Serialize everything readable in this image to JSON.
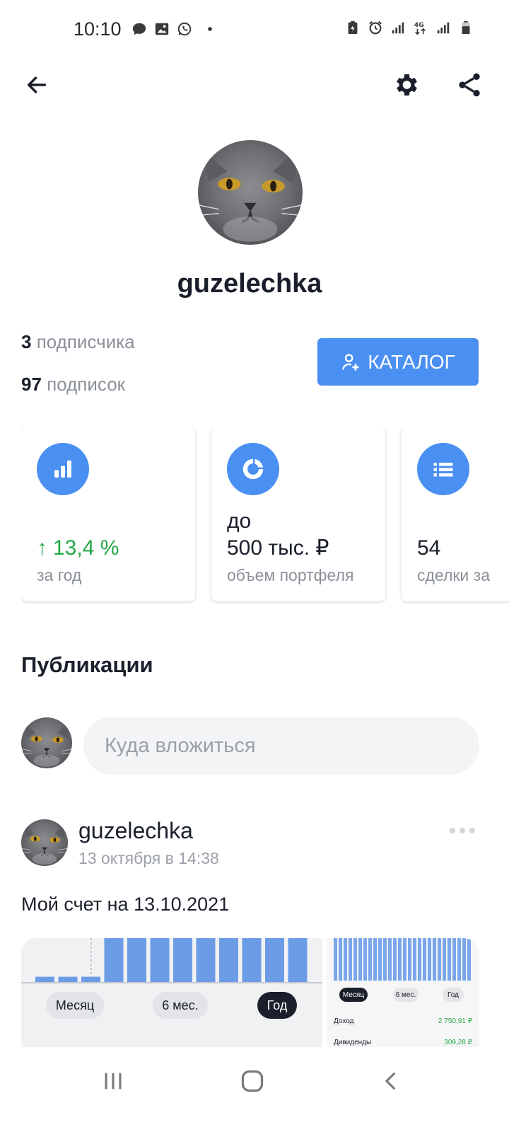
{
  "status_bar": {
    "time": "10:10",
    "left_icons": [
      "message-icon",
      "gallery-icon",
      "whatsapp-icon",
      "dot-icon"
    ],
    "right_icons": [
      "battery-saver-icon",
      "alarm-icon",
      "signal-icon",
      "4g-icon",
      "signal-icon",
      "battery-icon"
    ]
  },
  "header": {
    "back_icon": "arrow-left-icon",
    "settings_icon": "gear-icon",
    "share_icon": "share-icon"
  },
  "profile": {
    "username": "guzelechka",
    "followers_count": "3",
    "followers_label": "подписчика",
    "following_count": "97",
    "following_label": "подписок",
    "catalog_button": "КАТАЛОГ"
  },
  "stats": [
    {
      "icon": "bar-chart-icon",
      "arrow": "↑",
      "value": "13,4 %",
      "caption": "за год"
    },
    {
      "icon": "pie-chart-icon",
      "value_line1": "до",
      "value_line2": "500 тыс. ₽",
      "caption": "объем портфеля"
    },
    {
      "icon": "list-icon",
      "value": "54",
      "caption": "сделки за"
    }
  ],
  "publications": {
    "title": "Публикации",
    "composer_placeholder": "Куда вложиться"
  },
  "post": {
    "author": "guzelechka",
    "date": "13 октября в 14:38",
    "text": "Мой счет на 13.10.2021",
    "image_main": {
      "chips": [
        "Месяц",
        "6 мес.",
        "Год"
      ],
      "active_chip": "Год",
      "bar_levels": [
        0.12,
        0.12,
        0.12,
        1,
        1,
        1,
        1,
        1,
        1,
        1,
        1,
        1
      ]
    },
    "image_side": {
      "chips": [
        "Месяц",
        "6 мес.",
        "Год"
      ],
      "active_chip": "Месяц",
      "rows": [
        {
          "label": "Доход",
          "value": "2 750,91 ₽"
        },
        {
          "label": "Дивиденды",
          "value": "309,28 ₽"
        }
      ]
    }
  },
  "navbar": {
    "recents_icon": "recents-icon",
    "home_icon": "home-icon",
    "back_icon": "nav-back-icon"
  },
  "colors": {
    "accent": "#4a8ff2",
    "positive": "#22a846",
    "text": "#1a1f2b",
    "muted": "#8a8f99"
  }
}
